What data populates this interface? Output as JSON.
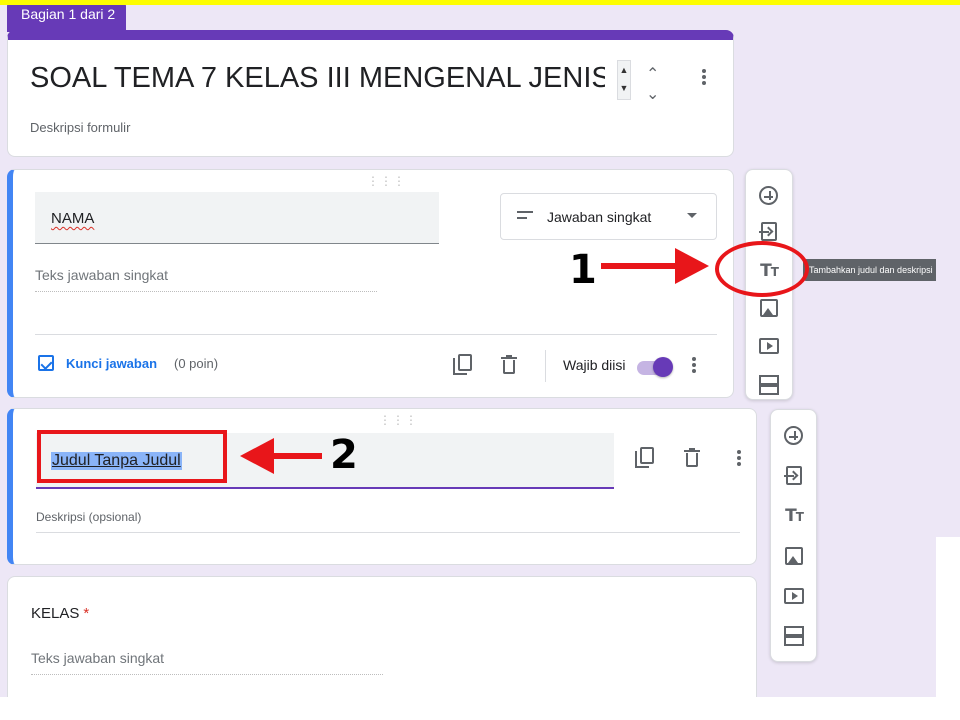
{
  "section_tab": "Bagian 1 dari 2",
  "form": {
    "title": "SOAL TEMA 7 KELAS III MENGENAL JENIS-",
    "description_placeholder": "Deskripsi formulir"
  },
  "question1": {
    "title": "NAMA",
    "type_label": "Jawaban singkat",
    "answer_placeholder": "Teks jawaban singkat",
    "answer_key_label": "Kunci jawaban",
    "points_label": "(0 poin)",
    "required_label": "Wajib diisi",
    "required_on": true
  },
  "toolbar_tooltip": "Tambahkan judul dan deskripsi",
  "title_block": {
    "title": "Judul Tanpa Judul",
    "description_placeholder": "Deskripsi (opsional)"
  },
  "question3": {
    "title": "KELAS",
    "required_mark": "*",
    "answer_placeholder": "Teks jawaban singkat"
  },
  "annotations": {
    "label_1": "1",
    "label_2": "2",
    "color": "#e8161a"
  },
  "colors": {
    "accent": "#673ab7",
    "active_border": "#4285f4",
    "link": "#1a73e8",
    "background": "#ede7f6"
  }
}
